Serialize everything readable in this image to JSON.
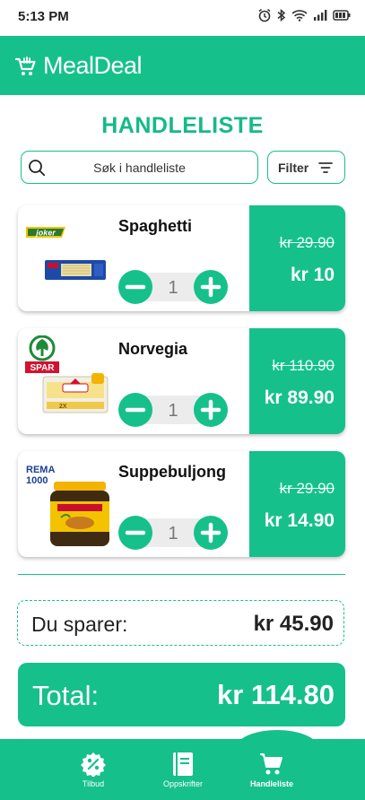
{
  "status_bar": {
    "time": "5:13 PM",
    "icons": [
      "alarm-icon",
      "bluetooth-icon",
      "wifi-icon",
      "signal-icon",
      "battery-icon"
    ]
  },
  "app": {
    "brand": "MealDeal",
    "brand_color": "#16c08b"
  },
  "page": {
    "title": "HANDLELISTE"
  },
  "search": {
    "placeholder": "Søk i handleliste",
    "filter_label": "Filter"
  },
  "items": [
    {
      "name": "Spaghetti",
      "store": "Joker",
      "quantity": "1",
      "old_price": "kr 29.90",
      "new_price": "kr 10"
    },
    {
      "name": "Norvegia",
      "store": "SPAR",
      "quantity": "1",
      "old_price": "kr 110.90",
      "new_price": "kr 89.90"
    },
    {
      "name": "Suppebuljong",
      "store": "REMA 1000",
      "quantity": "1",
      "old_price": "kr 29.90",
      "new_price": "kr 14.90"
    }
  ],
  "summary": {
    "savings_label": "Du sparer:",
    "savings_value": "kr 45.90",
    "total_label": "Total:",
    "total_value": "kr 114.80"
  },
  "bottom_nav": {
    "items": [
      {
        "label": "Tilbud",
        "icon": "discount-icon"
      },
      {
        "label": "Oppskrifter",
        "icon": "recipe-book-icon"
      },
      {
        "label": "Handleliste",
        "icon": "cart-icon",
        "active": true
      }
    ]
  }
}
